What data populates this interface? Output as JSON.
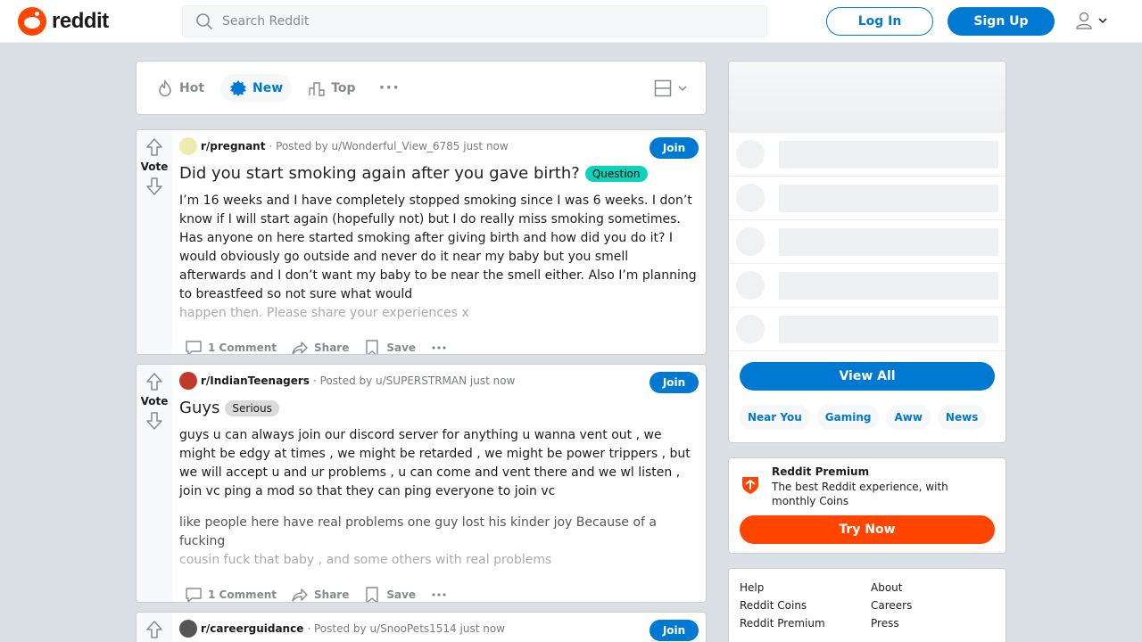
{
  "header": {
    "logo_text": "reddit",
    "search_placeholder": "Search Reddit",
    "login_label": "Log In",
    "signup_label": "Sign Up"
  },
  "sort": {
    "items": [
      {
        "label": "Hot",
        "icon": "flame-icon"
      },
      {
        "label": "New",
        "icon": "new-icon"
      },
      {
        "label": "Top",
        "icon": "top-icon"
      }
    ],
    "active": "New",
    "more": "···"
  },
  "posts": [
    {
      "subreddit": "r/pregnant",
      "posted_by": "· Posted by u/Wonderful_View_6785 just now",
      "title": "Did you start smoking again after you gave birth?",
      "flair": {
        "label": "Question",
        "bg": "#0dd3bb",
        "color": "#000000"
      },
      "body": "I’m 16 weeks and I have completely stopped smoking since I was 6 weeks. I don’t know if I will start again (hopefully not) but I do really miss smoking sometimes. Has anyone on here started smoking after giving birth and how did you do it? I would obviously go outside and never do it near my baby but you smell afterwards and I don’t want my baby to be near the smell either. Also I’m planning to breastfeed so not sure what would",
      "body_fade": "happen then. Please share your experiences x",
      "comments": "1 Comment",
      "share": "Share",
      "save": "Save",
      "vote": "Vote",
      "join": "Join"
    },
    {
      "subreddit": "r/IndianTeenagers",
      "posted_by": "· Posted by u/SUPERSTRMAN just now",
      "title": "Guys",
      "flair": {
        "label": "Serious",
        "bg": "#dadada",
        "color": "#1c1c1c"
      },
      "body": "guys u can always join our discord server for anything u wanna vent out , we might be edgy at times , we might be retarded , we might be power trippers , but we will accept u and ur problems , u can come and vent there and we wl listen , join vc ping a mod so that they can ping everyone to join vc",
      "body2": "like people here have real problems one guy lost his kinder joy Because of a fucking",
      "body_fade": "cousin fuck that baby , and some others with real problems",
      "comments": "1 Comment",
      "share": "Share",
      "save": "Save",
      "vote": "Vote",
      "join": "Join"
    },
    {
      "subreddit": "r/careerguidance",
      "posted_by": "· Posted by u/SnooPets1514 just now",
      "join": "Join"
    }
  ],
  "sidebar": {
    "view_all": "View All",
    "chips": [
      "Near You",
      "Gaming",
      "Aww",
      "News"
    ],
    "premium_title": "Reddit Premium",
    "premium_desc": "The best Reddit experience, with monthly Coins",
    "try_now": "Try Now",
    "footer": {
      "left": [
        "Help",
        "Reddit Coins",
        "Reddit Premium"
      ],
      "right": [
        "About",
        "Careers",
        "Press"
      ]
    }
  },
  "colors": {
    "brand": "#ff4500",
    "accent": "#0079d3"
  }
}
